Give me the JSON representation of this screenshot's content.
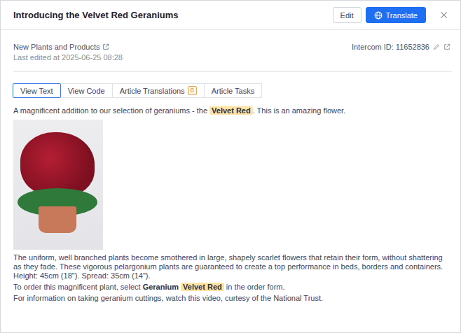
{
  "dialog": {
    "title": "Introducing the Velvet Red Geraniums",
    "buttons": [
      {
        "label": "Edit",
        "kind": "outline"
      },
      {
        "label": "Translate",
        "kind": "primary"
      }
    ]
  },
  "meta": {
    "category": "New Plants and Products",
    "last_edited": "Last edited at 2025-06-25 08:28",
    "intercom_id": "Intercom ID: 11652836"
  },
  "tabs": [
    {
      "label": "View Text",
      "selected": true,
      "badge": ""
    },
    {
      "label": "View Code",
      "selected": false,
      "badge": ""
    },
    {
      "label": "Article Translations",
      "selected": false,
      "badge": "0"
    },
    {
      "label": "Article Tasks",
      "selected": false,
      "badge": ""
    }
  ],
  "body": [
    {
      "kind": "paragraph",
      "segments": [
        {
          "kind": "plain",
          "text": "A magnificent addition to our selection of geraniums - the "
        },
        {
          "kind": "highlight",
          "text": "Velvet Red"
        },
        {
          "kind": "plain",
          "text": ". This is an amazing flower."
        }
      ]
    },
    {
      "kind": "image",
      "segments": []
    },
    {
      "kind": "paragraph",
      "segments": [
        {
          "kind": "plain",
          "text": "The uniform, well branched plants become smothered in large, shapely scarlet flowers that retain their form, without shattering as they fade. These vigorous pelargonium plants are guaranteed to create a top performance in beds, borders and containers. Height: 45cm (18\"). Spread: 35cm (14\")."
        }
      ]
    },
    {
      "kind": "paragraph",
      "segments": [
        {
          "kind": "plain",
          "text": "To order this magnificent plant, select "
        },
        {
          "kind": "bold",
          "text": "Geranium"
        },
        {
          "kind": "plain",
          "text": " "
        },
        {
          "kind": "highlight",
          "text": "Velvet Red"
        },
        {
          "kind": "plain",
          "text": " in the order form."
        }
      ]
    },
    {
      "kind": "paragraph",
      "segments": [
        {
          "kind": "plain",
          "text": "For information on taking geranium cuttings, watch this video, curtesy of the National Trust."
        }
      ]
    }
  ]
}
